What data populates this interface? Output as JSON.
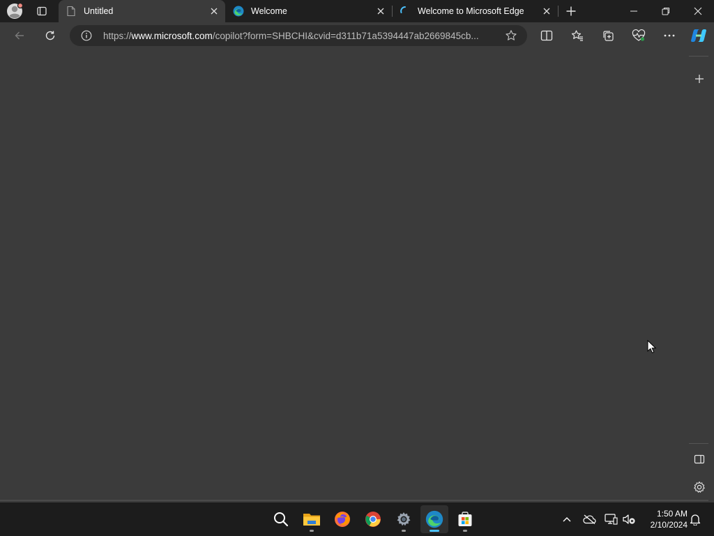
{
  "browser": {
    "tabs": [
      {
        "title": "Untitled",
        "icon": "page-icon",
        "active": true
      },
      {
        "title": "Welcome",
        "icon": "edge-logo-icon",
        "active": false
      },
      {
        "title": "Welcome to Microsoft Edge",
        "icon": "loading-spinner-icon",
        "active": false
      }
    ],
    "address": {
      "scheme": "https://",
      "host": "www.microsoft.com",
      "path": "/copilot?form=SHBCHI&cvid=d311b71a5394447ab2669845cb..."
    }
  },
  "taskbar": {
    "apps": [
      "search-icon",
      "file-explorer-icon",
      "firefox-icon",
      "chrome-icon",
      "settings-icon",
      "edge-icon",
      "store-icon"
    ],
    "clock": {
      "time": "1:50 AM",
      "date": "2/10/2024"
    }
  },
  "colors": {
    "tab_strip": "#1f1f1f",
    "page_bg": "#3b3b3b",
    "taskbar": "#1c1c1c",
    "accent": "#4cc2ff"
  }
}
